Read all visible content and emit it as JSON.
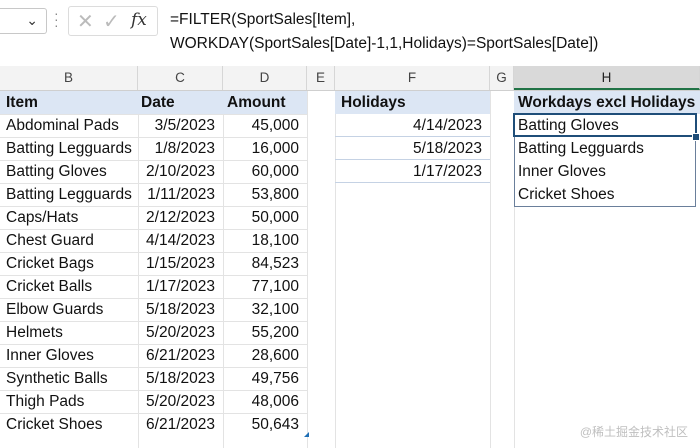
{
  "formula_bar": {
    "chevron": "⌄",
    "cancel_icon": "✕",
    "enter_icon": "✓",
    "fx_label": "fx",
    "formula_line1": "=FILTER(SportSales[Item],",
    "formula_line2": "WORKDAY(SportSales[Date]-1,1,Holidays)=SportSales[Date])"
  },
  "columns": [
    "B",
    "C",
    "D",
    "E",
    "F",
    "G",
    "H"
  ],
  "selected_column": "H",
  "sport_sales": {
    "headers": [
      "Item",
      "Date",
      "Amount"
    ],
    "rows": [
      [
        "Abdominal Pads",
        "3/5/2023",
        "45,000"
      ],
      [
        "Batting Legguards",
        "1/8/2023",
        "16,000"
      ],
      [
        "Batting Gloves",
        "2/10/2023",
        "60,000"
      ],
      [
        "Batting Legguards",
        "1/11/2023",
        "53,800"
      ],
      [
        "Caps/Hats",
        "2/12/2023",
        "50,000"
      ],
      [
        "Chest Guard",
        "4/14/2023",
        "18,100"
      ],
      [
        "Cricket Bags",
        "1/15/2023",
        "84,523"
      ],
      [
        "Cricket Balls",
        "1/17/2023",
        "77,100"
      ],
      [
        "Elbow Guards",
        "5/18/2023",
        "32,100"
      ],
      [
        "Helmets",
        "5/20/2023",
        "55,200"
      ],
      [
        "Inner Gloves",
        "6/21/2023",
        "28,600"
      ],
      [
        "Synthetic Balls",
        "5/18/2023",
        "49,756"
      ],
      [
        "Thigh Pads",
        "5/20/2023",
        "48,006"
      ],
      [
        "Cricket Shoes",
        "6/21/2023",
        "50,643"
      ]
    ]
  },
  "holidays": {
    "header": "Holidays",
    "dates": [
      "4/14/2023",
      "5/18/2023",
      "1/17/2023"
    ]
  },
  "result": {
    "header": "Workdays excl Holidays",
    "items": [
      "Batting Gloves",
      "Batting Legguards",
      "Inner Gloves",
      "Cricket Shoes"
    ]
  },
  "watermark": "@稀土掘金技术社区",
  "colors": {
    "table_header": "#dce6f4",
    "selection": "#1f4e79",
    "excel_green": "#217346"
  }
}
